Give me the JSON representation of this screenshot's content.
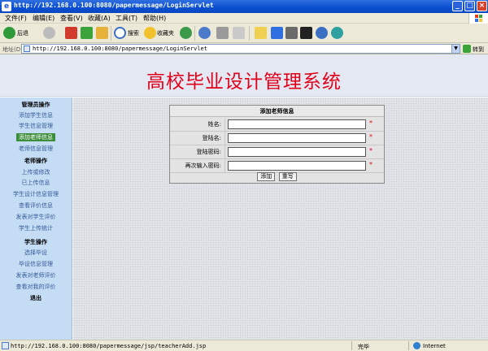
{
  "window": {
    "title": "http://192.168.0.100:8080/papermessage/LoginServlet"
  },
  "menu": [
    "文件(F)",
    "编辑(E)",
    "查看(V)",
    "收藏(A)",
    "工具(T)",
    "帮助(H)"
  ],
  "toolbar": {
    "back_label": "后退",
    "search_label": "搜索",
    "favorites_label": "收藏夹"
  },
  "address": {
    "label": "地址(D)",
    "url": "http://192.168.0.100:8080/papermessage/LoginServlet",
    "go_label": "转到"
  },
  "banner": {
    "title": "高校毕业设计管理系统"
  },
  "sidebar": {
    "admin_header": "管理员操作",
    "admin_items": [
      "添加学生信息",
      "学生信息管理",
      "添加老师信息",
      "老师信息管理"
    ],
    "teacher_header": "老师操作",
    "teacher_items": [
      "上传或修改",
      "已上传信息",
      "学生设计信息管理",
      "查看评价信息",
      "发表对学生评价",
      "学生上传统计"
    ],
    "student_header": "学生操作",
    "student_items": [
      "选择毕设",
      "毕设信息管理",
      "发表对老师评价",
      "查看对我的评价"
    ],
    "logout": "退出"
  },
  "form": {
    "caption": "添加老师信息",
    "fields": [
      {
        "label": "姓名:",
        "value": ""
      },
      {
        "label": "登陆名:",
        "value": ""
      },
      {
        "label": "登陆密码:",
        "value": ""
      },
      {
        "label": "再次输入密码:",
        "value": ""
      }
    ],
    "required_mark": "*",
    "add_button": "添加",
    "reset_button": "重写"
  },
  "status": {
    "url": "http://192.168.0.100:8080/papermessage/jsp/teacherAdd.jsp",
    "done": "完毕",
    "zone": "Internet"
  }
}
